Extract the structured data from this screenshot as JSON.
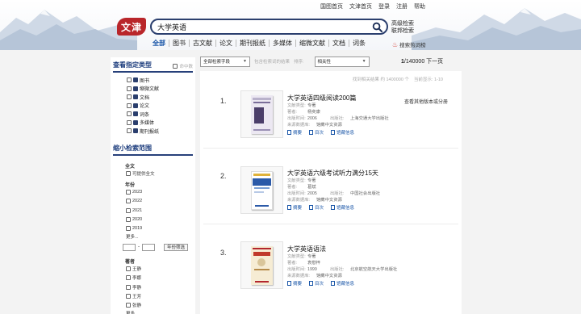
{
  "header": {
    "top_links": [
      "国图首页",
      "文津首页",
      "登录",
      "注册",
      "帮助"
    ],
    "logo_text": "文津",
    "search_value": "大学英语",
    "advanced_search": "高级检索",
    "linked_search": "联邦检索",
    "nav_tabs": [
      "全部",
      "图书",
      "古文献",
      "论文",
      "期刊报纸",
      "多媒体",
      "缩微文献",
      "文档",
      "词条"
    ],
    "hot_search": "搜索热词榜"
  },
  "sidebar": {
    "type_title": "查看指定类型",
    "type_hint": "命中数",
    "types": [
      "图书",
      "缩微文献",
      "文档",
      "论文",
      "词条",
      "多媒体",
      "期刊报纸"
    ],
    "narrow_title": "缩小检索范围",
    "fulltext_title": "全文",
    "fulltext_option": "可提供全文",
    "year_title": "年份",
    "years": [
      "2023",
      "2022",
      "2021",
      "2020",
      "2019"
    ],
    "more": "更多...",
    "year_filter_btn": "年份筛选",
    "author_title": "著者",
    "authors": [
      "王静",
      "李娜",
      "李静",
      "王芳",
      "张静"
    ]
  },
  "filterbar": {
    "field_select": "全部检索字段",
    "within_label": "包含检索词的结果",
    "sort_label": "排序:",
    "sort_select": "相关性",
    "pager_current": "1",
    "pager_total": "/140000",
    "pager_next": "下一页"
  },
  "stats": {
    "found": "找到相关结果 约 1400000 个",
    "current": "当前显示: 1-10"
  },
  "labels": {
    "doc_type": "文献类型:",
    "author": "著者:",
    "year": "出版时间:",
    "publisher": "出版社:",
    "source": "来源数据库:",
    "summary": "摘要",
    "toc": "目次",
    "holdings": "馆藏信息",
    "other_versions": "查看其他版本或分册"
  },
  "results": [
    {
      "num": "1.",
      "title": "大学英语四级阅读200篇",
      "doc_type": "专著",
      "author": "杨奕康",
      "year": "2006",
      "publisher": "上海交通大学出版社",
      "source": "馆藏中文资源",
      "cover_color": "#ece8f2",
      "cover_accent": "#5a4a78",
      "show_other_versions": true
    },
    {
      "num": "2.",
      "title": "大学英语六级考试听力满分15天",
      "doc_type": "专著",
      "author": "葛斌",
      "year": "2005",
      "publisher": "中国社会出版社",
      "source": "馆藏中文资源",
      "cover_color": "#ffffff",
      "cover_accent": "#2b5aa8",
      "show_other_versions": false
    },
    {
      "num": "3.",
      "title": "大学英语语法",
      "doc_type": "专著",
      "author": "袁懋梓",
      "year": "1999",
      "publisher": "北京航空航天大学出版社",
      "source": "馆藏中文资源",
      "cover_color": "#f6ecd4",
      "cover_accent": "#b3262d",
      "show_other_versions": false
    }
  ]
}
